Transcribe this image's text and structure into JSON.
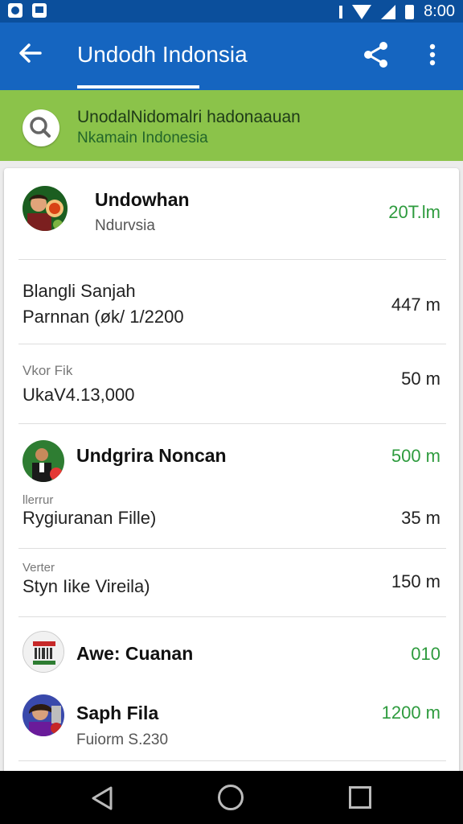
{
  "status_bar": {
    "time": "8:00"
  },
  "app_bar": {
    "title": "Undodh Indonsia"
  },
  "banner": {
    "line1": "UnodalNidomalri hadonaauan",
    "line2": "Nkamain Indonesia"
  },
  "items": [
    {
      "name": "Undowhan",
      "sub": "Ndurvsia",
      "value": "20T.lm"
    },
    {
      "line1": "Blangli Sanjah",
      "line2": "Parnnan (øk/ 1/2200",
      "value": "447 m"
    },
    {
      "small": "Vkor Fik",
      "line2": "UkaV4.13,000",
      "value": "50 m"
    },
    {
      "name": "Undgrira Noncan",
      "value": "500 m"
    },
    {
      "small": "llerrur",
      "line2": "Rygiuranan Fille)",
      "value": "35 m"
    },
    {
      "small": "Verter",
      "line2": "Styn Iike Vireila)",
      "value": "150 m"
    },
    {
      "name": "Awe: Cuanan",
      "value": "010"
    },
    {
      "name": "Saph Fila",
      "sub": "Fuiorm S.230",
      "value": "1200 m"
    }
  ],
  "colors": {
    "status_bar": "#0b4f9c",
    "app_bar": "#1565c0",
    "banner": "#8bc34a",
    "accent_green": "#2e9b3e"
  }
}
